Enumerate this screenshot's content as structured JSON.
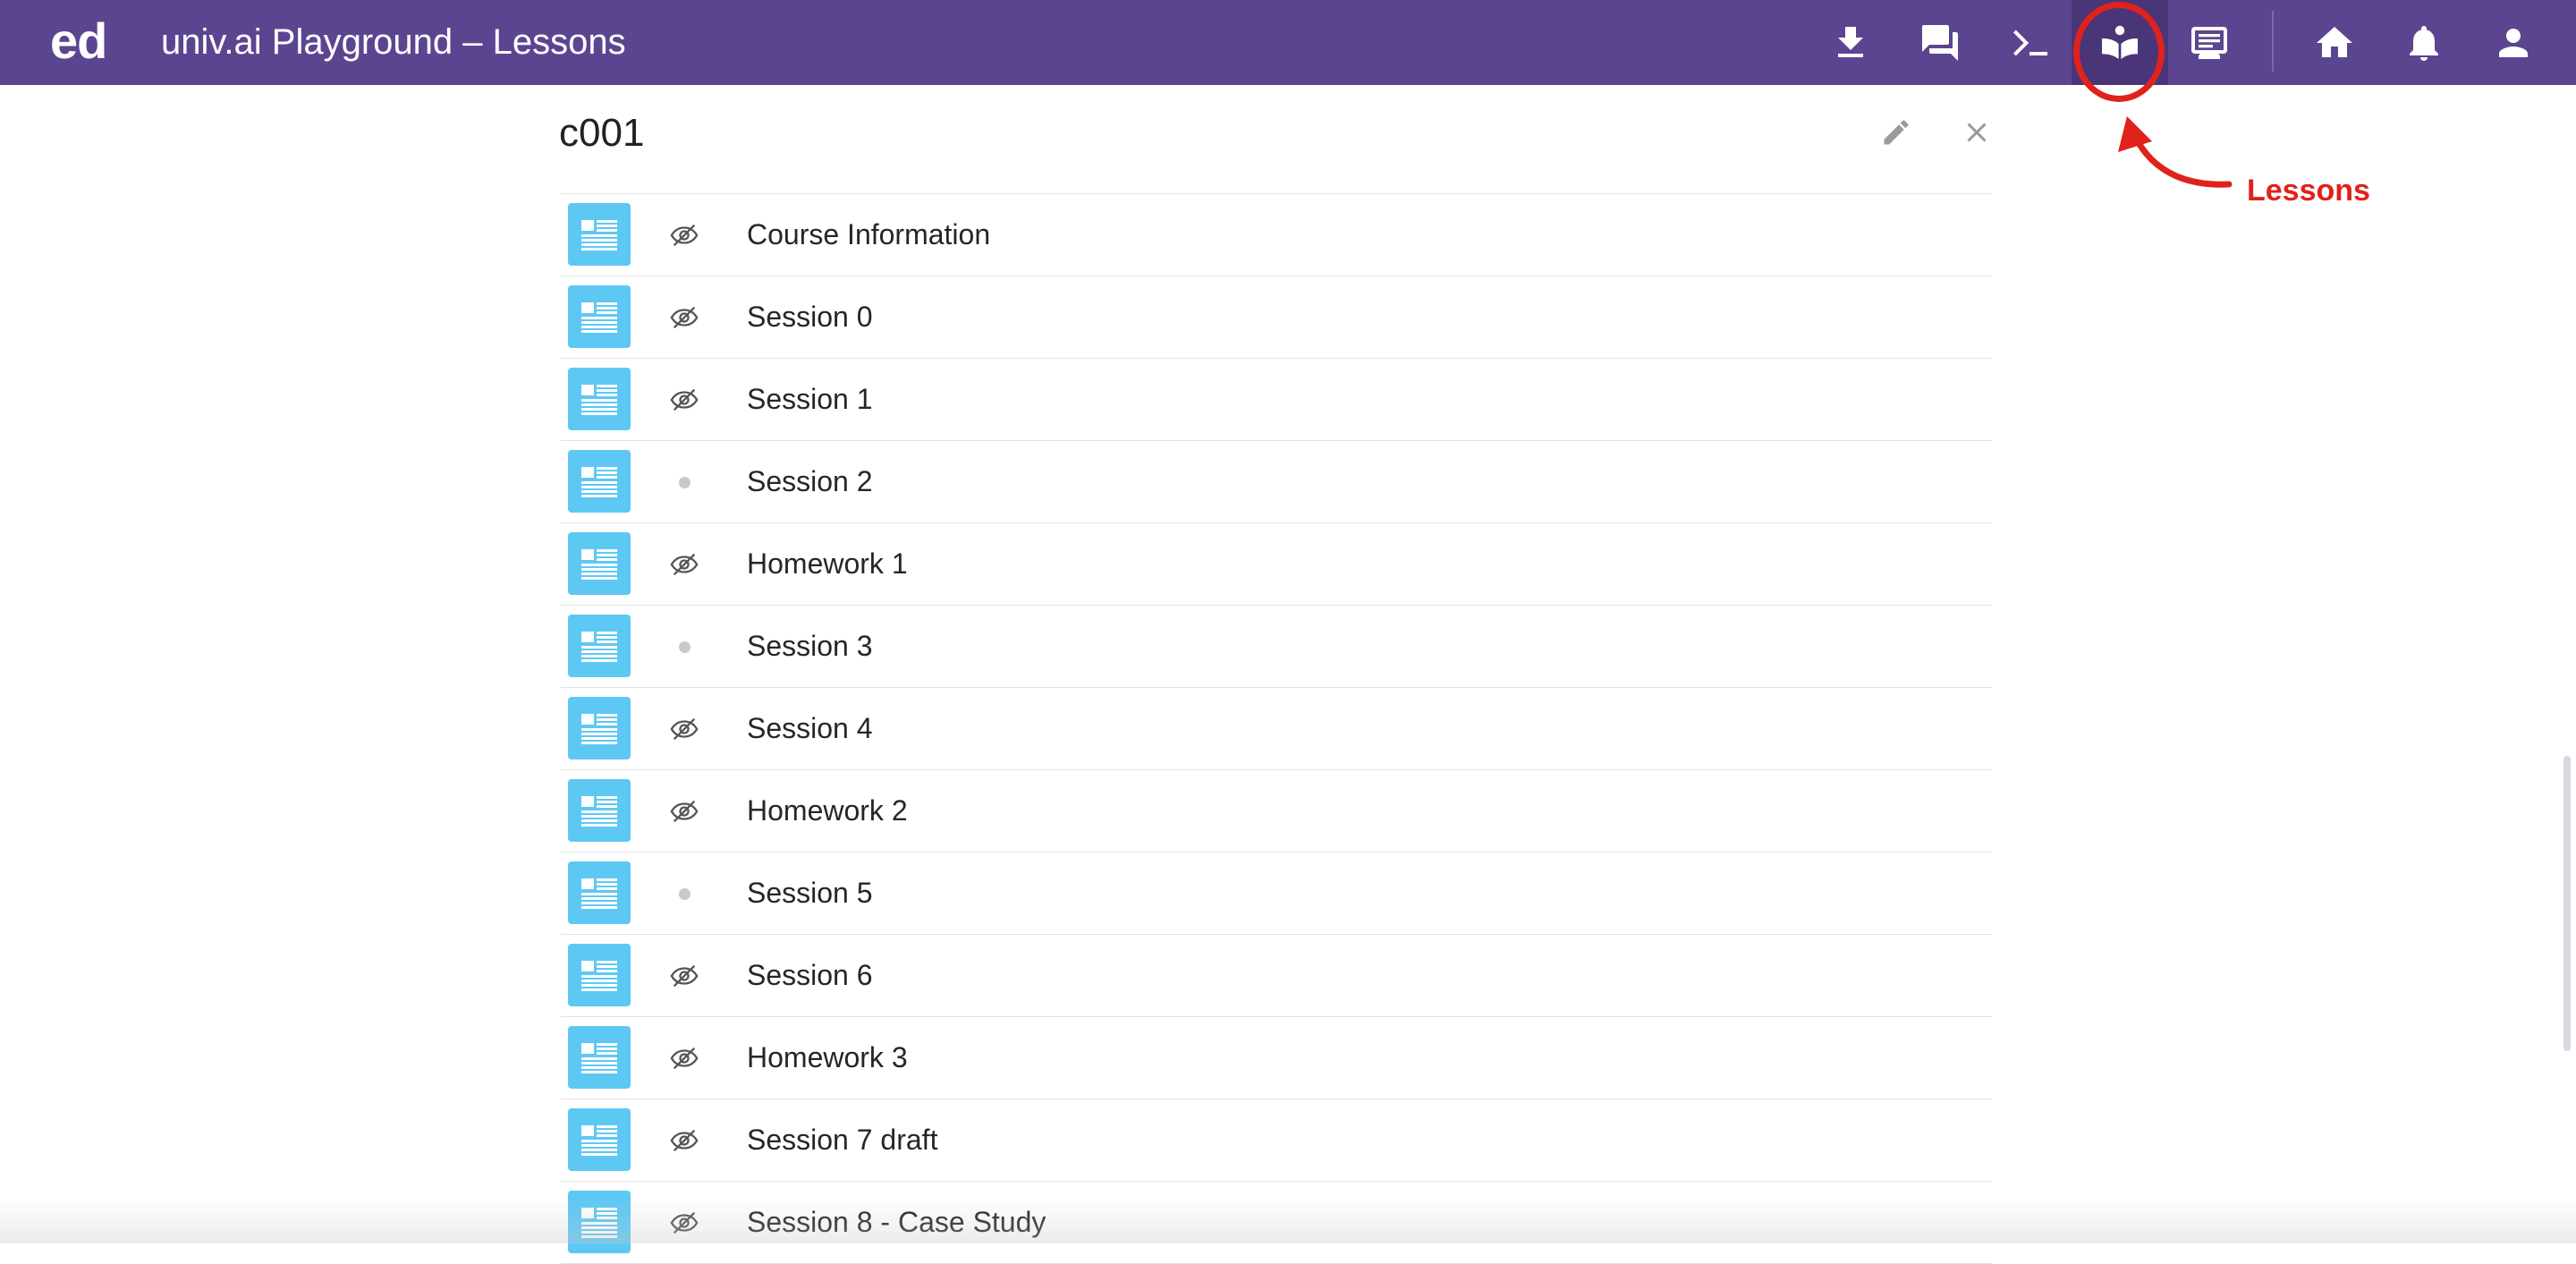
{
  "app": {
    "logo": "ed",
    "title": "univ.ai Playground – Lessons"
  },
  "toolbar": {
    "icons": [
      {
        "name": "download-icon"
      },
      {
        "name": "discussion-icon"
      },
      {
        "name": "terminal-icon"
      },
      {
        "name": "lessons-icon",
        "active": true
      },
      {
        "name": "slides-icon"
      },
      {
        "name": "home-icon"
      },
      {
        "name": "notifications-icon"
      },
      {
        "name": "account-icon"
      }
    ],
    "bar_color": "#5c4590"
  },
  "annotation": {
    "label": "Lessons",
    "color": "#e0221c"
  },
  "panel": {
    "title": "c001",
    "edit_icon": "pencil-icon",
    "close_icon": "close-icon"
  },
  "lessons": [
    {
      "title": "Course Information",
      "status": "hidden"
    },
    {
      "title": "Session 0",
      "status": "hidden"
    },
    {
      "title": "Session 1",
      "status": "hidden"
    },
    {
      "title": "Session 2",
      "status": "visible"
    },
    {
      "title": "Homework 1",
      "status": "hidden"
    },
    {
      "title": "Session 3",
      "status": "visible"
    },
    {
      "title": "Session 4",
      "status": "hidden"
    },
    {
      "title": "Homework 2",
      "status": "hidden"
    },
    {
      "title": "Session 5",
      "status": "visible"
    },
    {
      "title": "Session 6",
      "status": "hidden"
    },
    {
      "title": "Homework 3",
      "status": "hidden"
    },
    {
      "title": "Session 7 draft",
      "status": "hidden"
    },
    {
      "title": "Session 8 - Case Study",
      "status": "hidden"
    }
  ],
  "colors": {
    "doc_icon": "#5ec8f4",
    "accent": "#5c4590"
  }
}
